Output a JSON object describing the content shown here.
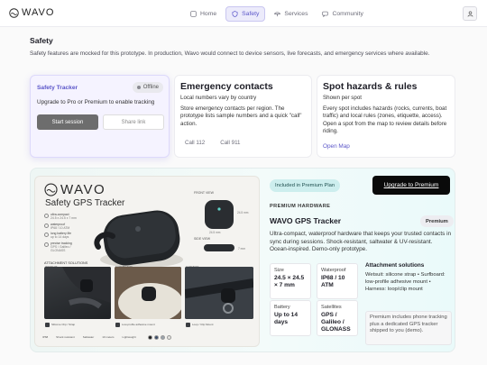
{
  "nav": {
    "logo": "WAVO",
    "items": [
      {
        "label": "Home",
        "icon": "home-icon"
      },
      {
        "label": "Safety",
        "icon": "shield-icon",
        "active": true
      },
      {
        "label": "Services",
        "icon": "umbrella-icon"
      },
      {
        "label": "Community",
        "icon": "chat-icon"
      }
    ],
    "avatar_icon": "user-icon",
    "active_color": "#5b56c9"
  },
  "page": {
    "title": "Safety",
    "intro": "Safety features are mocked for this prototype. In production, Wavo would connect to device sensors, live forecasts, and emergency services where available."
  },
  "tracker": {
    "title": "Safety Tracker",
    "status": "Offline",
    "description": "Upgrade to Pro or Premium to enable tracking",
    "start_label": "Start session",
    "share_label": "Share link"
  },
  "contacts": {
    "title": "Emergency contacts",
    "subtitle": "Local numbers vary by country",
    "body": "Store emergency contacts per region. The prototype lists sample numbers and a quick \"call\" action.",
    "calls": [
      "Call 112",
      "Call 911"
    ]
  },
  "hazards": {
    "title": "Spot hazards & rules",
    "subtitle": "Shown per spot",
    "body": "Every spot includes hazards (rocks, currents, boat traffic) and local rules (zones, etiquette, access). Open a spot from the map to review details before riding.",
    "link": "Open Map"
  },
  "poster": {
    "logo": "WAVO",
    "title": "Safety GPS Tracker",
    "specs": [
      {
        "label": "ultra-compact",
        "value": "24.5 x 24.5 x 7 mm"
      },
      {
        "label": "waterproof",
        "value": "IP68 / 10 ATM"
      },
      {
        "label": "long battery life",
        "value": "up to 14 days"
      },
      {
        "label": "precise tracking",
        "value": "GPS / Galileo / GLONASS"
      }
    ],
    "front_view": "FRONT VIEW",
    "side_view": "SIDE VIEW",
    "dim_h": "24.5 mm",
    "dim_w": "24.5 mm",
    "dim_d": "7 mm",
    "attachment_label": "ATTACHMENT SOLUTIONS",
    "photo_captions": [
      "WETSUIT",
      "SURFBOARD",
      "HARNESS"
    ],
    "strap_captions": [
      "Silicone Clip / Strap",
      "Low-profile adhesive mount",
      "Loop / Clip Mount"
    ],
    "strip": [
      "IP68",
      "Shock resistant",
      "Saltwater",
      "10 meters",
      "Lightweight"
    ],
    "swatch_colors": [
      "#1c1c1c",
      "#3e4f6a",
      "#9aa3ab",
      "#e4e4e0"
    ]
  },
  "product": {
    "included_badge": "Included in Premium Plan",
    "upgrade_label": "Upgrade to Premium",
    "kicker": "PREMIUM HARDWARE",
    "name": "WAVO GPS Tracker",
    "tier": "Premium",
    "description": "Ultra-compact, waterproof hardware that keeps your trusted contacts in sync during sessions. Shock-resistant, saltwater & UV-resistant. Ocean-inspired. Demo-only prototype.",
    "specs": [
      {
        "key": "Size",
        "value": "24.5 × 24.5 × 7 mm"
      },
      {
        "key": "Waterproof",
        "value": "IP68 / 10 ATM"
      },
      {
        "key": "Battery",
        "value": "Up to 14 days"
      },
      {
        "key": "Satellites",
        "value": "GPS / Galileo / GLONASS"
      }
    ],
    "attachment_title": "Attachment solutions",
    "attachment_body": "Wetsuit: silicone strap • Surfboard: low-profile adhesive mount • Harness: loop/clip mount",
    "note": "Premium includes phone tracking plus a dedicated GPS tracker shipped to you (demo)."
  }
}
